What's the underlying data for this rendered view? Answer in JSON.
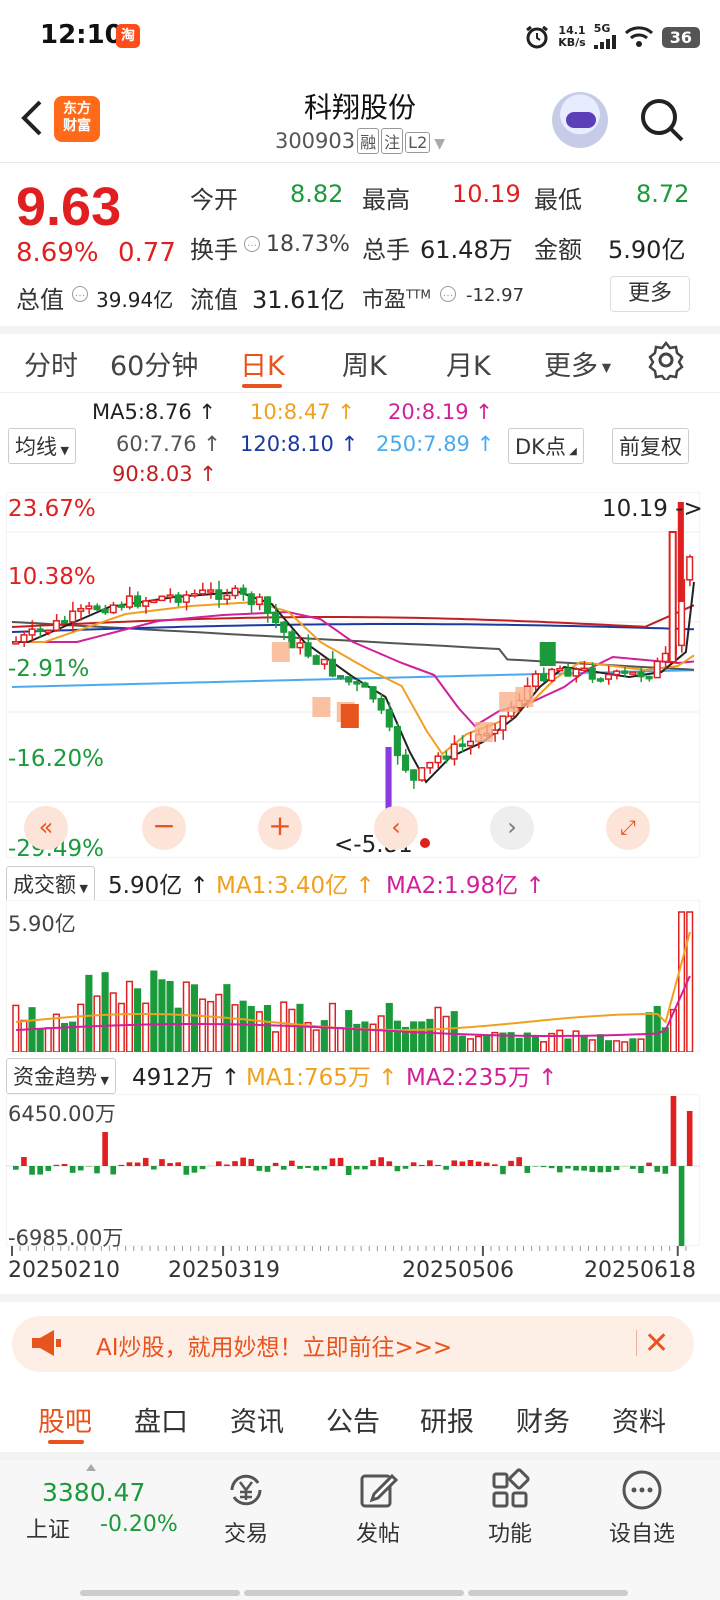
{
  "status_bar": {
    "time": "12:10",
    "app_badge": "淘",
    "net_speed_value": "14.1",
    "net_speed_unit": "KB/s",
    "network": "5G",
    "battery": "36"
  },
  "header": {
    "logo_line1": "东方",
    "logo_line2": "财富",
    "stock_name": "科翔股份",
    "stock_code": "300903",
    "tags": [
      "融",
      "注",
      "L2"
    ]
  },
  "quote": {
    "price": "9.63",
    "change_pct": "8.69%",
    "change_amt": "0.77",
    "open_label": "今开",
    "open": "8.82",
    "high_label": "最高",
    "high": "10.19",
    "low_label": "最低",
    "low": "8.72",
    "turnover_label": "换手",
    "turnover": "18.73%",
    "volume_label": "总手",
    "volume": "61.48万",
    "amount_label": "金额",
    "amount": "5.90亿",
    "mktcap_label": "总值",
    "mktcap": "39.94亿",
    "float_label": "流值",
    "float_cap": "31.61亿",
    "pe_label": "市盈",
    "pe_sup": "TTM",
    "pe": "-12.97",
    "more_label": "更多"
  },
  "period_tabs": [
    "分时",
    "60分钟",
    "日K",
    "周K",
    "月K",
    "更多"
  ],
  "active_period": "日K",
  "ma_legend": {
    "selector": "均线",
    "ma5": "MA5:8.76",
    "ma10": "10:8.47",
    "ma20": "20:8.19",
    "ma60": "60:7.76",
    "ma120": "120:8.10",
    "ma250": "250:7.89",
    "ma90": "90:8.03",
    "dk_button": "DK点",
    "adjust_button": "前复权",
    "colors": {
      "ma5": "#222222",
      "ma10": "#f0a020",
      "ma20": "#d0209a",
      "ma60": "#555555",
      "ma120": "#1a3aa0",
      "ma250": "#4aaaf0",
      "ma90": "#c02020"
    }
  },
  "main_chart": {
    "y_labels": [
      "23.67%",
      "10.38%",
      "-2.91%",
      "-16.20%",
      "-29.49%"
    ],
    "high_marker": "10.19",
    "low_marker": "<-5.81"
  },
  "volume_panel": {
    "selector": "成交额",
    "value": "5.90亿",
    "ma1": "MA1:3.40亿",
    "ma2": "MA2:1.98亿",
    "max_label": "5.90亿"
  },
  "flow_panel": {
    "selector": "资金趋势",
    "value": "4912万",
    "ma1": "MA1:765万",
    "ma2": "MA2:235万",
    "max_label": "6450.00万",
    "min_label": "-6985.00万"
  },
  "x_dates": [
    "20250210",
    "20250319",
    "20250506",
    "20250618"
  ],
  "ad": {
    "text": "AI炒股，就用妙想！立即前往>>>"
  },
  "content_tabs": [
    "股吧",
    "盘口",
    "资讯",
    "公告",
    "研报",
    "财务",
    "资料"
  ],
  "active_content_tab": "股吧",
  "bottom_nav": {
    "index_value": "3380.47",
    "index_name": "上证",
    "index_change": "-0.20%",
    "items": [
      "交易",
      "发帖",
      "功能",
      "设自选"
    ]
  },
  "chart_data": {
    "type": "candlestick",
    "x": [
      "20250210",
      "20250319",
      "20250506",
      "20250618"
    ],
    "up_color": "#e02020",
    "down_color": "#1a9a3a",
    "price_high": 10.19,
    "price_low": 5.81,
    "ma_values": {
      "MA5": 8.76,
      "MA10": 8.47,
      "MA20": 8.19,
      "MA60": 7.76,
      "MA90": 8.03,
      "MA120": 8.1,
      "MA250": 7.89
    },
    "y_ticks_pct": [
      "23.67%",
      "10.38%",
      "-2.91%",
      "-16.20%",
      "-29.49%"
    ],
    "volume_max": "5.90亿",
    "flow_range": [
      "-6985.00万",
      "6450.00万"
    ]
  }
}
